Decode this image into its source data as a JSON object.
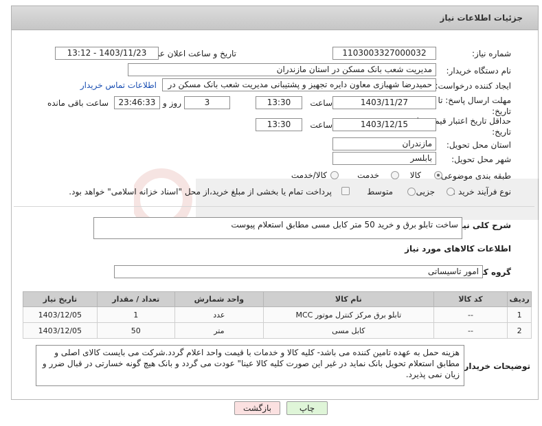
{
  "header": {
    "title": "جزئیات اطلاعات نیاز"
  },
  "fields": {
    "need_number_label": "شماره نیاز:",
    "need_number": "1103003327000032",
    "announce_label": "تاریخ و ساعت اعلان عمومی:",
    "announce_value": "1403/11/23 - 13:12",
    "buyer_label": "نام دستگاه خریدار:",
    "buyer_value": "مدیریت شعب بانک مسکن در استان مازندران",
    "creator_label": "ایجاد کننده درخواست:",
    "creator_value": "حمیدرضا شهبازی معاون دایره تجهیز و پشتیبانی  مدیریت شعب بانک مسکن در",
    "contact_link": "اطلاعات تماس خریدار",
    "deadline_label": "مهلت ارسال پاسخ: تا تاریخ:",
    "deadline_date": "1403/11/27",
    "time_label": "ساعت",
    "deadline_time": "13:30",
    "days_value": "3",
    "days_label": "روز و",
    "remaining_time": "23:46:33",
    "remaining_label": "ساعت باقی مانده",
    "validity_label": "حداقل تاریخ اعتبار قیمت: تا تاریخ:",
    "validity_date": "1403/12/15",
    "validity_time_label": "ساعت",
    "validity_time": "13:30",
    "province_label": "استان محل تحویل:",
    "province_value": "مازندران",
    "city_label": "شهر محل تحویل:",
    "city_value": "بابلسر",
    "category_label": "طبقه بندی موضوعی:",
    "category_options": [
      "کالا",
      "خدمت",
      "کالا/خدمت"
    ],
    "process_label": "نوع فرآیند خرید :",
    "process_options": [
      "جزیی",
      "متوسط"
    ],
    "payment_note": "پرداخت تمام یا بخشی از مبلغ خرید،از محل \"اسناد خزانه اسلامی\" خواهد بود."
  },
  "description": {
    "label": "شرح کلی نیاز:",
    "value": "ساخت تابلو برق و خرید 50 متر کابل مسی مطابق استعلام پیوست"
  },
  "goods_info": {
    "title": "اطلاعات کالاهای مورد نیاز",
    "group_label": "گروه کالا:",
    "group_value": "امور تاسیساتی"
  },
  "table": {
    "headers": [
      "ردیف",
      "کد کالا",
      "نام کالا",
      "واحد شمارش",
      "تعداد / مقدار",
      "تاریخ نیاز"
    ],
    "rows": [
      [
        "1",
        "--",
        "تابلو برق مرکز کنترل موتور MCC",
        "عدد",
        "1",
        "1403/12/05"
      ],
      [
        "2",
        "--",
        "کابل مسی",
        "متر",
        "50",
        "1403/12/05"
      ]
    ]
  },
  "notes": {
    "label": "توضیحات خریدار:",
    "value": "هزینه حمل به عهده تامین کننده می باشد- کلیه کالا و خدمات با قیمت واحد اعلام گردد.شرکت می بایست کالای اصلی و مطابق استعلام تحویل بانک نماید در غیر این صورت کلیه کالا عینا\" عودت می گردد و بانک هیچ  گونه  خسارتی در قبال ضرر و زیان  نمی پذیرد."
  },
  "buttons": {
    "print": "چاپ",
    "back": "بازگشت"
  },
  "colors": {
    "header_bg": "#cfcfcf",
    "link": "#1a4fb3",
    "print_btn": "#dff5d8",
    "back_btn": "#fbe1e1"
  }
}
